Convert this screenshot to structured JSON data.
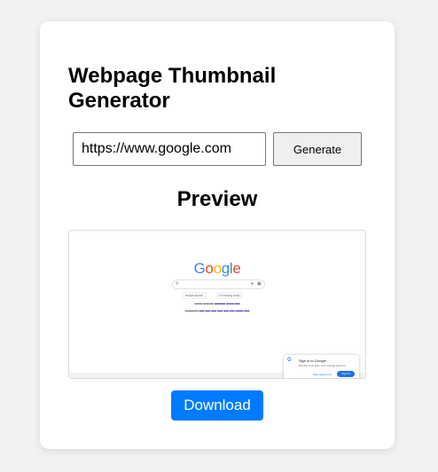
{
  "title": "Webpage Thumbnail Generator",
  "url_input": {
    "value": "https://www.google.com"
  },
  "generate_label": "Generate",
  "preview_heading": "Preview",
  "thumbnail": {
    "logo_letters": [
      "G",
      "o",
      "o",
      "g",
      "l",
      "e"
    ],
    "logo_colors": [
      "#4285f4",
      "#ea4335",
      "#fbbc05",
      "#4285f4",
      "#34a853",
      "#ea4335"
    ],
    "search_button": "Google Search",
    "lucky_button": "I'm Feeling Lucky",
    "signin_title": "Sign in to Google",
    "signin_text": "Get the most from your Google account",
    "signin_dismiss": "Stay signed out",
    "signin_button": "Sign in"
  },
  "download_label": "Download",
  "colors": {
    "accent": "#007bff",
    "page_background": "#f2f2f2",
    "card_background": "#ffffff"
  }
}
